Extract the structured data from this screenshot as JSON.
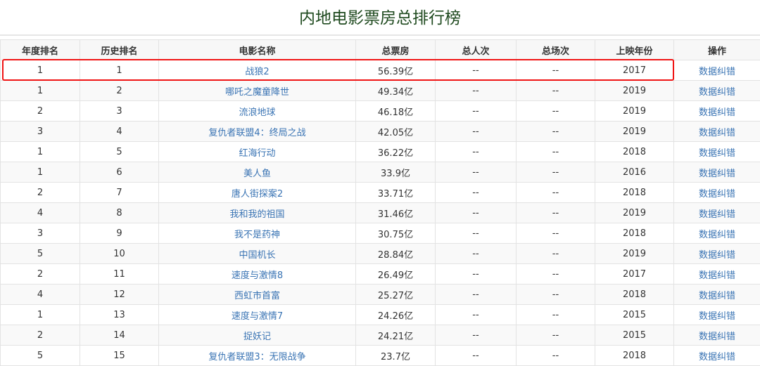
{
  "title": "内地电影票房总排行榜",
  "columns": [
    "年度排名",
    "历史排名",
    "电影名称",
    "总票房",
    "总人次",
    "总场次",
    "上映年份",
    "操作"
  ],
  "highlight_color": "#f01414",
  "rows": [
    [
      "1",
      "1",
      "战狼2",
      "56.39亿",
      "--",
      "--",
      "2017",
      "数据纠错"
    ],
    [
      "1",
      "2",
      "哪吒之魔童降世",
      "49.34亿",
      "--",
      "--",
      "2019",
      "数据纠错"
    ],
    [
      "2",
      "3",
      "流浪地球",
      "46.18亿",
      "--",
      "--",
      "2019",
      "数据纠错"
    ],
    [
      "3",
      "4",
      "复仇者联盟4：终局之战",
      "42.05亿",
      "--",
      "--",
      "2019",
      "数据纠错"
    ],
    [
      "1",
      "5",
      "红海行动",
      "36.22亿",
      "--",
      "--",
      "2018",
      "数据纠错"
    ],
    [
      "1",
      "6",
      "美人鱼",
      "33.9亿",
      "--",
      "--",
      "2016",
      "数据纠错"
    ],
    [
      "2",
      "7",
      "唐人街探案2",
      "33.71亿",
      "--",
      "--",
      "2018",
      "数据纠错"
    ],
    [
      "4",
      "8",
      "我和我的祖国",
      "31.46亿",
      "--",
      "--",
      "2019",
      "数据纠错"
    ],
    [
      "3",
      "9",
      "我不是药神",
      "30.75亿",
      "--",
      "--",
      "2018",
      "数据纠错"
    ],
    [
      "5",
      "10",
      "中国机长",
      "28.84亿",
      "--",
      "--",
      "2019",
      "数据纠错"
    ],
    [
      "2",
      "11",
      "速度与激情8",
      "26.49亿",
      "--",
      "--",
      "2017",
      "数据纠错"
    ],
    [
      "4",
      "12",
      "西虹市首富",
      "25.27亿",
      "--",
      "--",
      "2018",
      "数据纠错"
    ],
    [
      "1",
      "13",
      "速度与激情7",
      "24.26亿",
      "--",
      "--",
      "2015",
      "数据纠错"
    ],
    [
      "2",
      "14",
      "捉妖记",
      "24.21亿",
      "--",
      "--",
      "2015",
      "数据纠错"
    ],
    [
      "5",
      "15",
      "复仇者联盟3：无限战争",
      "23.7亿",
      "--",
      "--",
      "2018",
      "数据纠错"
    ]
  ]
}
